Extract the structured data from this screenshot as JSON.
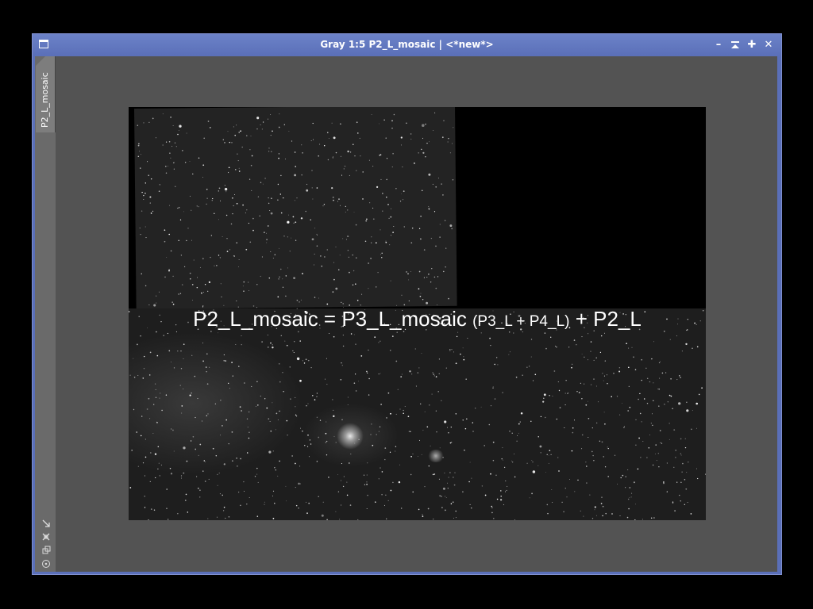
{
  "window": {
    "title": "Gray 1:5 P2_L_mosaic | <*new*>",
    "buttons": [
      {
        "name": "minimize",
        "glyph": "–"
      },
      {
        "name": "shade",
        "glyph": "⪢"
      },
      {
        "name": "maximize",
        "glyph": "✚"
      },
      {
        "name": "close",
        "glyph": "✕"
      }
    ]
  },
  "sidebar": {
    "tab_label": "P2_L_mosaic",
    "icons": [
      "zoom-arrow-icon",
      "fit-icon",
      "clone-icon",
      "target-icon"
    ]
  },
  "image": {
    "overlay_main": "P2_L_mosaic = P3_L_mosaic ",
    "overlay_small": "(P3_L + P4_L)",
    "overlay_tail": " + P2_L"
  },
  "colors": {
    "title_bar": "#5a6fb8",
    "workspace": "#535353",
    "sidebar": "#6a6a6a"
  }
}
